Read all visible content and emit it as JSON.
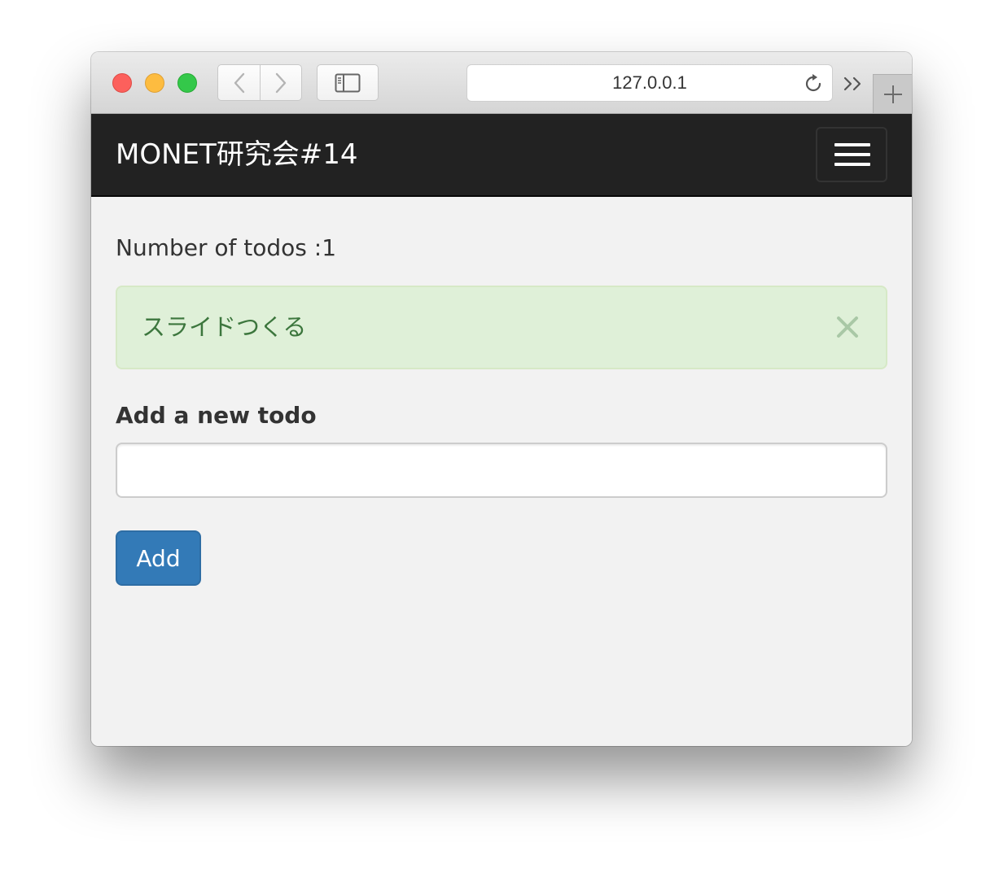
{
  "browser": {
    "address": "127.0.0.1",
    "icons": {
      "back": "chevron-left-icon",
      "forward": "chevron-right-icon",
      "sidebar": "sidebar-icon",
      "reload": "reload-icon",
      "more": "double-chevron-right-icon",
      "new_tab": "plus-icon"
    }
  },
  "navbar": {
    "brand": "MONET研究会#14",
    "menu_icon": "hamburger-icon",
    "background": "#222222"
  },
  "main": {
    "todo_count_label": "Number of todos :1",
    "todos": [
      {
        "text": "スライドつくる"
      }
    ],
    "form": {
      "label": "Add a new todo",
      "input_value": "",
      "submit_label": "Add"
    }
  },
  "colors": {
    "alert_background": "#dff0d8",
    "alert_text": "#3c763d",
    "primary_button": "#337ab7",
    "page_background": "#f2f2f2"
  }
}
